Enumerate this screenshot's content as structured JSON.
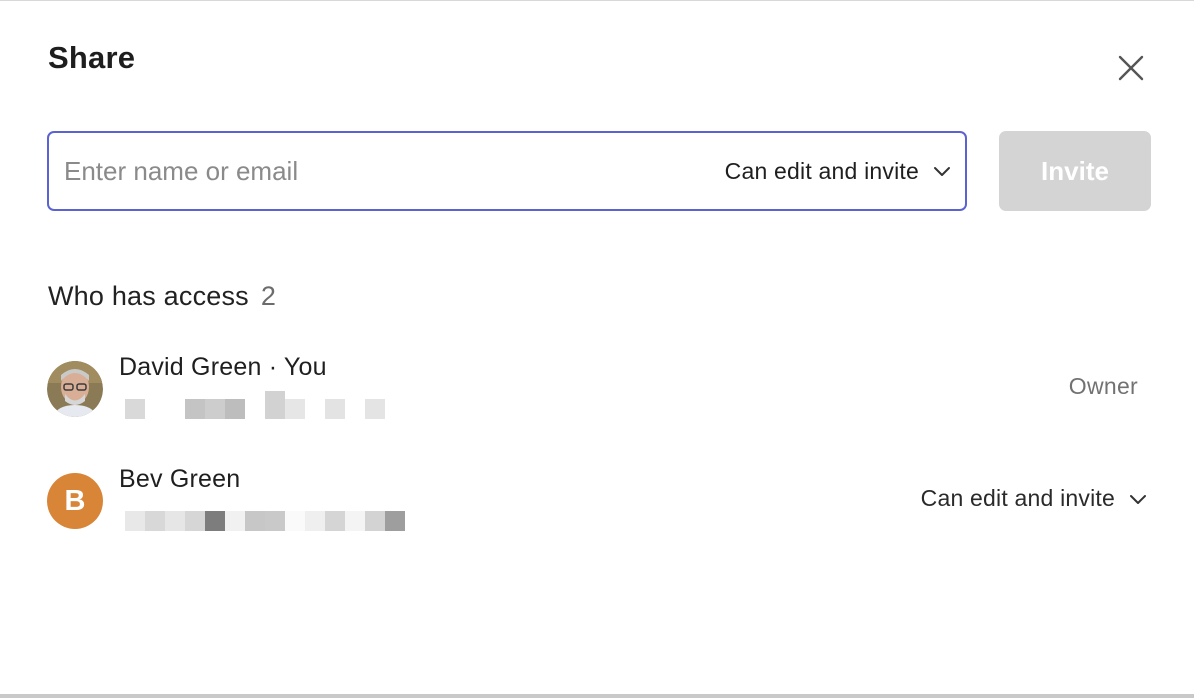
{
  "dialog": {
    "title": "Share",
    "close_icon": "close-icon"
  },
  "invite": {
    "placeholder": "Enter name or email",
    "value": "",
    "permission": "Can edit and invite",
    "button_label": "Invite"
  },
  "access": {
    "heading": "Who has access",
    "count": "2",
    "members": [
      {
        "name": "David Green · You",
        "avatar": "photo",
        "role": "Owner",
        "email_redacted": true
      },
      {
        "name": "Bev Green",
        "avatar_letter": "B",
        "avatar_color": "#d88537",
        "role": "Can edit and invite",
        "email_redacted": true
      }
    ]
  },
  "colors": {
    "input_border": "#5b63d3",
    "invite_disabled_bg": "#d4d4d4"
  }
}
